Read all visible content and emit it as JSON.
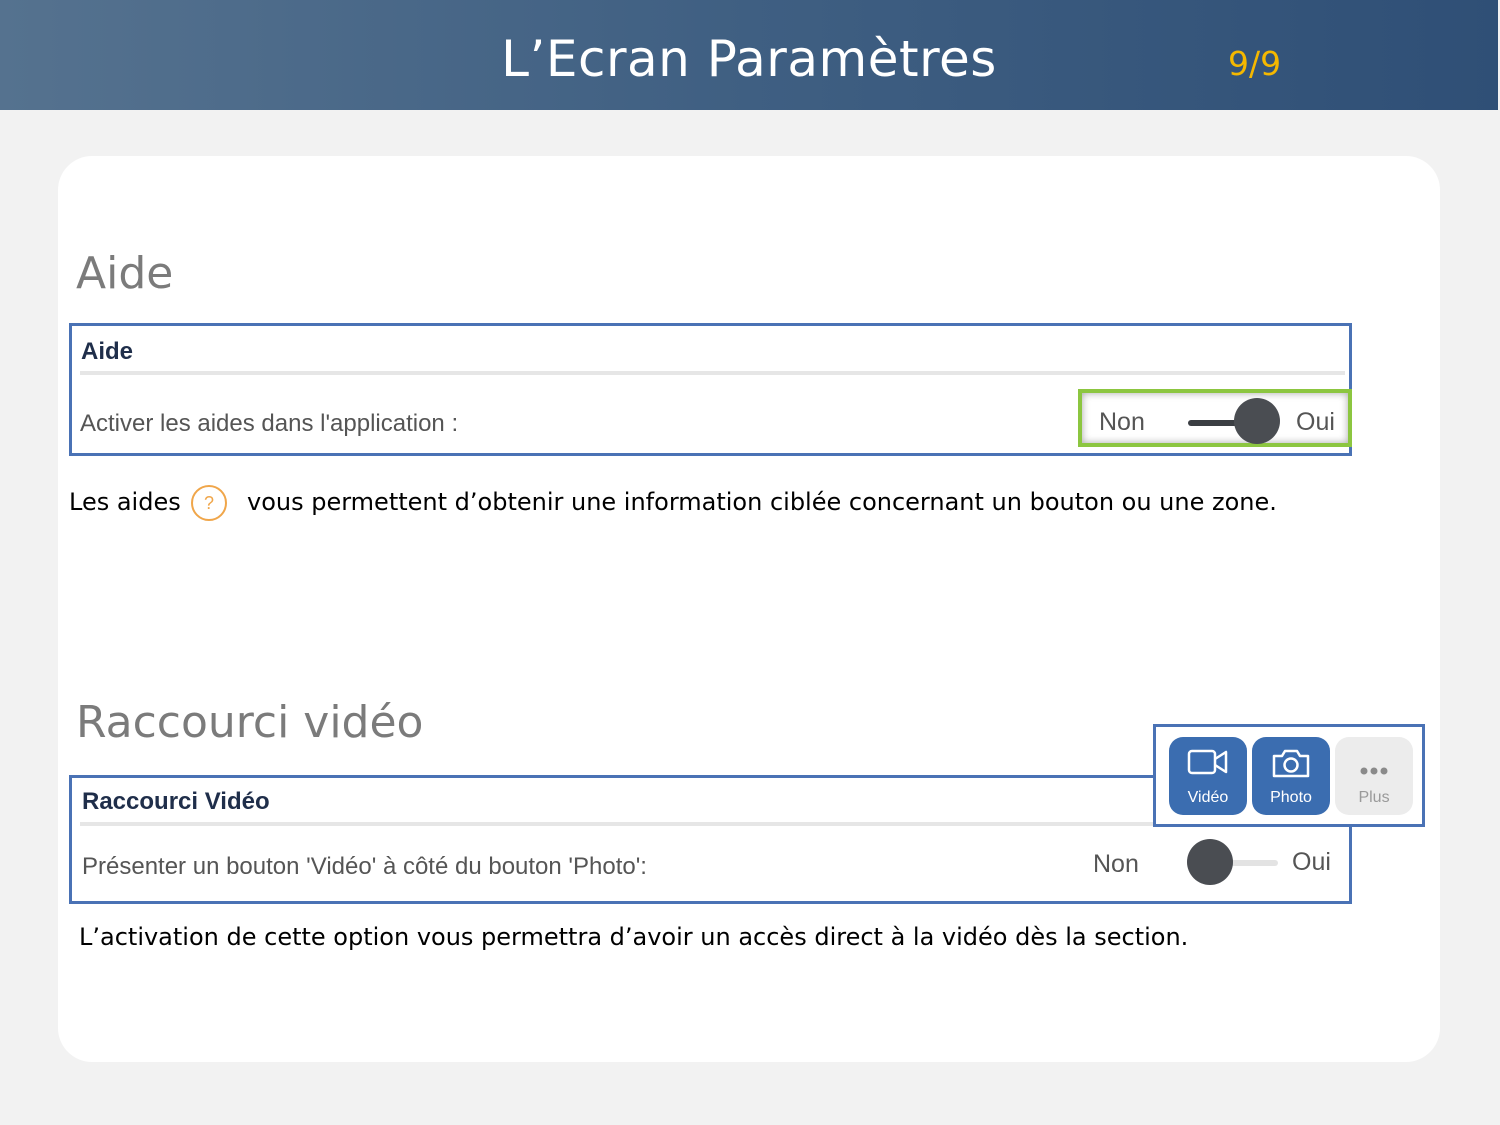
{
  "header": {
    "title": "L’Ecran Paramètres",
    "page": "9/9"
  },
  "aide": {
    "section_title": "Aide",
    "panel_title": "Aide",
    "row_label": "Activer les aides dans l'application :",
    "toggle": {
      "off_label": "Non",
      "on_label": "Oui",
      "value": "Oui"
    },
    "desc_before": "Les aides",
    "help_glyph": "?",
    "desc_after": "vous permettent d’obtenir une information ciblée concernant un bouton ou une zone."
  },
  "video": {
    "section_title": "Raccourci vidéo",
    "panel_title": "Raccourci Vidéo",
    "row_label": "Présenter un bouton 'Vidéo' à côté du bouton 'Photo':",
    "toggle": {
      "off_label": "Non",
      "on_label": "Oui",
      "value": "Non"
    },
    "desc": "L’activation de cette option vous permettra d’avoir un accès direct à la vidéo dès la section.",
    "shortcut_buttons": [
      {
        "label": "Vidéo",
        "icon": "video-camera-icon"
      },
      {
        "label": "Photo",
        "icon": "camera-icon"
      },
      {
        "label": "Plus",
        "icon": "more-dots-icon"
      }
    ]
  },
  "colors": {
    "accent_blue": "#4a72b5",
    "page_number": "#f5b800",
    "highlight_green": "#8cc640",
    "help_orange": "#f0a64a"
  }
}
